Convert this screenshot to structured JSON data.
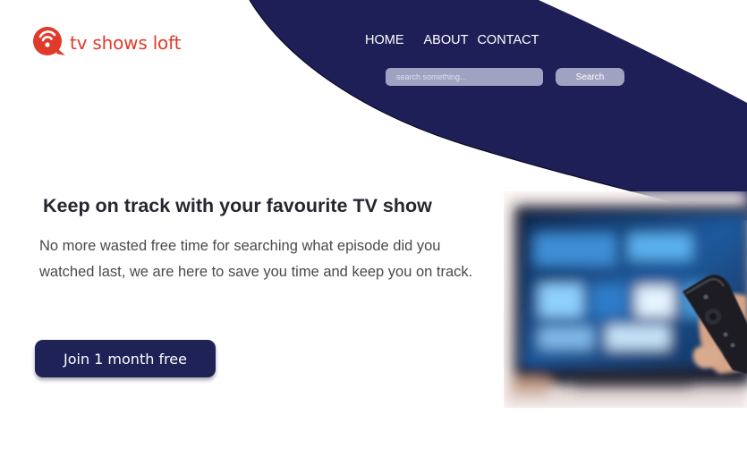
{
  "brand": {
    "name": "tv shows loft",
    "color": "#e03a2a",
    "icon": "broadcast-logo-icon"
  },
  "nav": {
    "items": [
      {
        "label": "HOME"
      },
      {
        "label": "ABOUT"
      },
      {
        "label": "CONTACT"
      }
    ]
  },
  "search": {
    "placeholder": "search something...",
    "value": "",
    "button_label": "Search"
  },
  "hero": {
    "title": "Keep on track with your favourite TV show",
    "description": "No more wasted free time for searching what episode did you watched last, we are here to save you time and keep you on track.",
    "cta_label": "Join 1 month free",
    "image": "tv-remote-photo"
  },
  "colors": {
    "navy": "#1f2257",
    "search_bg": "#9fa3c1",
    "text_dark": "#262630",
    "text_body": "#4a4a4a"
  }
}
